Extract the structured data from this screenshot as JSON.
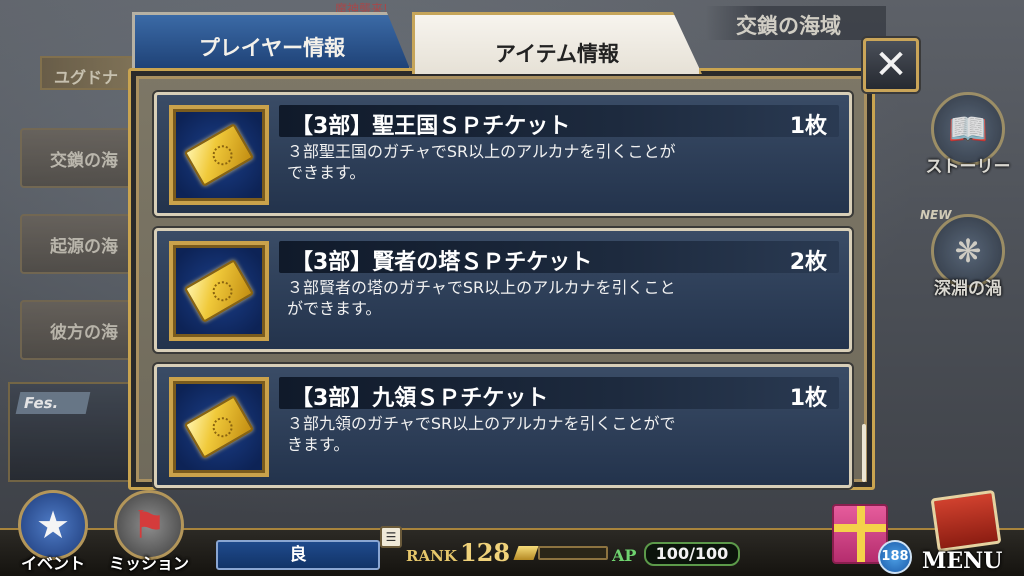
{
  "background": {
    "top_banner": "魔神襲来!",
    "left_top_item": "ユグドナ",
    "left_items": [
      "交鎖の海",
      "起源の海",
      "彼方の海"
    ],
    "fes_label": "Fes.",
    "area_title": "交鎖の海域"
  },
  "side_buttons": [
    {
      "label": "ストーリー",
      "icon": "book-icon"
    },
    {
      "label": "深淵の渦",
      "badge": "NEW",
      "icon": "vortex-icon"
    }
  ],
  "modal": {
    "tabs": [
      {
        "label": "プレイヤー情報",
        "active": false
      },
      {
        "label": "アイテム情報",
        "active": true
      }
    ],
    "close_label": "✕",
    "items": [
      {
        "name": "【3部】聖王国ＳＰチケット",
        "quantity": "1枚",
        "description": "３部聖王国のガチャでSR以上のアルカナを引くことができます。",
        "icon": "gold-ticket-icon"
      },
      {
        "name": "【3部】賢者の塔ＳＰチケット",
        "quantity": "2枚",
        "description": "３部賢者の塔のガチャでSR以上のアルカナを引くことができます。",
        "icon": "gold-ticket-icon"
      },
      {
        "name": "【3部】九領ＳＰチケット",
        "quantity": "1枚",
        "description": "３部九領のガチャでSR以上のアルカナを引くことができます。",
        "icon": "gold-ticket-icon"
      }
    ]
  },
  "hud": {
    "event_label": "イベント",
    "mission_label": "ミッション",
    "status": "良",
    "rank_label": "RANK",
    "rank_value": "128",
    "ap_label": "AP",
    "ap_value": "100/100",
    "gift_count": "188",
    "menu_label": "MENU"
  },
  "colors": {
    "frame_gold": "#c9a450",
    "card_blue": "#2c3d58",
    "active_tab": "#f2eee6",
    "inactive_tab": "#2a5592"
  }
}
